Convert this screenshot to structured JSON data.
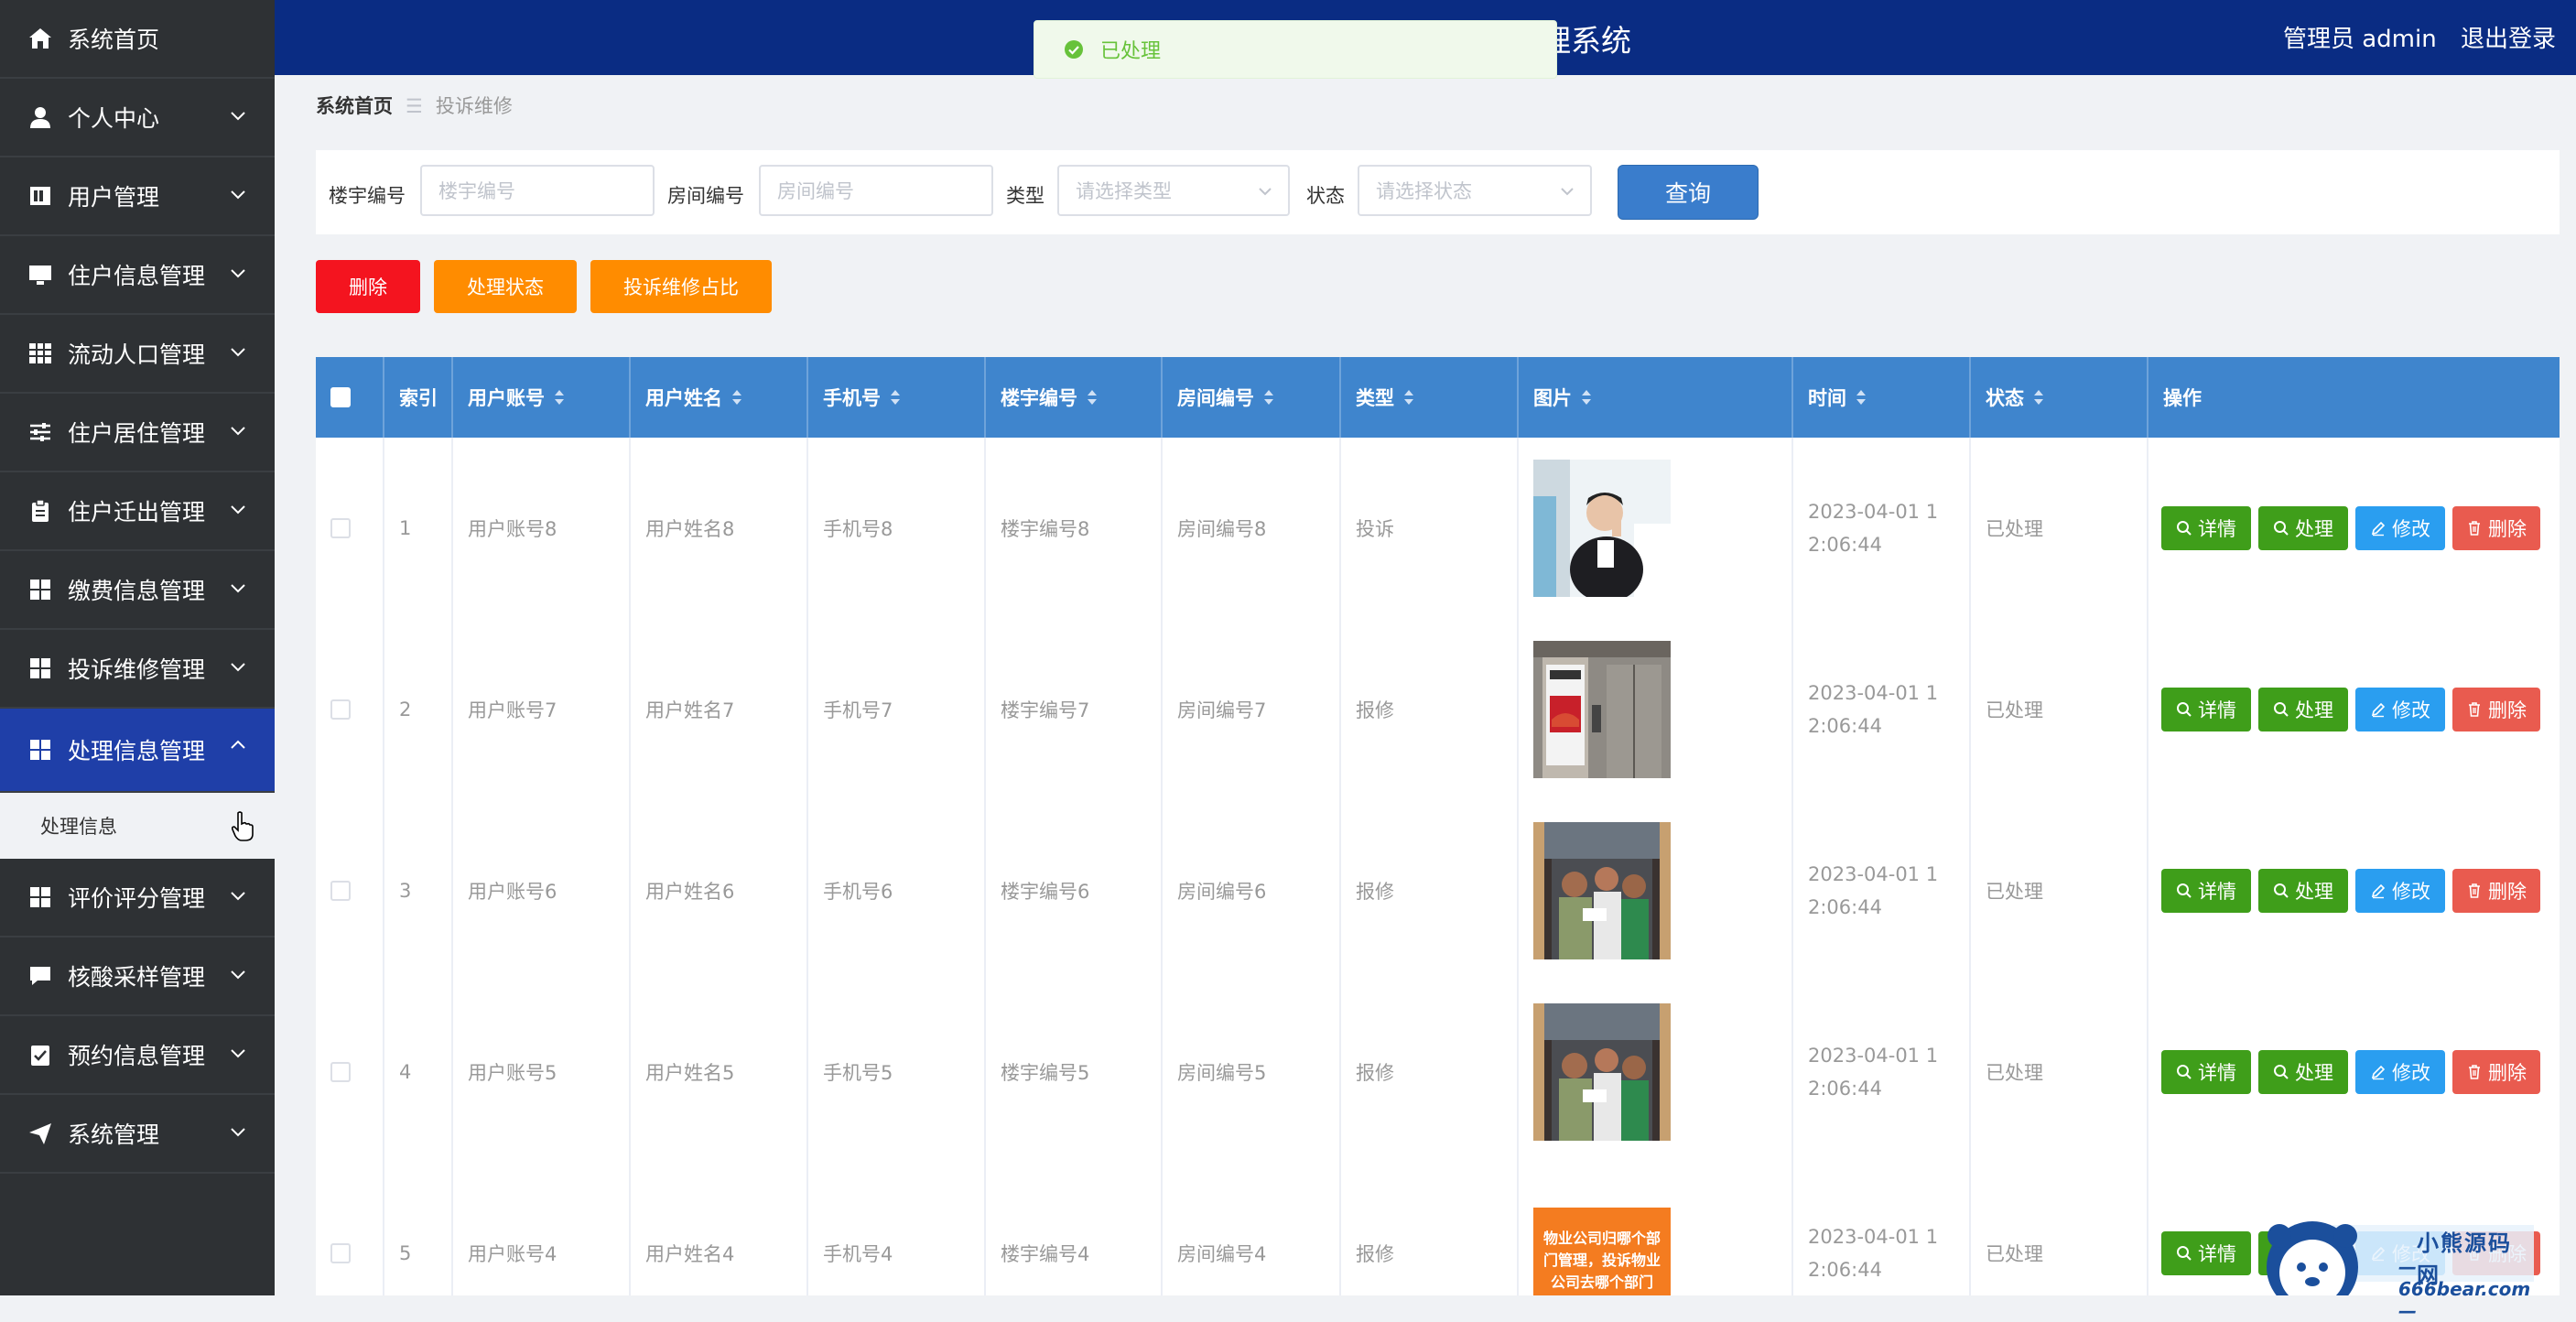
{
  "sidebar": {
    "items": [
      {
        "label": "系统首页",
        "icon": "home-icon"
      },
      {
        "label": "个人中心",
        "icon": "person-icon"
      },
      {
        "label": "用户管理",
        "icon": "users-icon"
      },
      {
        "label": "住户信息管理",
        "icon": "monitor-icon"
      },
      {
        "label": "流动人口管理",
        "icon": "grid-icon"
      },
      {
        "label": "住户居住管理",
        "icon": "sliders-icon"
      },
      {
        "label": "住户迁出管理",
        "icon": "clipboard-icon"
      },
      {
        "label": "缴费信息管理",
        "icon": "apps-icon"
      },
      {
        "label": "投诉维修管理",
        "icon": "apps-icon"
      },
      {
        "label": "处理信息管理",
        "icon": "apps-icon"
      },
      {
        "label": "评价评分管理",
        "icon": "apps-icon"
      },
      {
        "label": "核酸采样管理",
        "icon": "chat-icon"
      },
      {
        "label": "预约信息管理",
        "icon": "checklist-icon"
      },
      {
        "label": "系统管理",
        "icon": "send-icon"
      }
    ],
    "submenu": {
      "label": "处理信息"
    }
  },
  "header": {
    "title": "管理系统",
    "user_role": "管理员 admin",
    "logout": "退出登录"
  },
  "toast": {
    "message": "已处理"
  },
  "breadcrumb": {
    "home": "系统首页",
    "current": "投诉维修"
  },
  "search": {
    "building_label": "楼宇编号",
    "building_placeholder": "楼宇编号",
    "room_label": "房间编号",
    "room_placeholder": "房间编号",
    "type_label": "类型",
    "type_placeholder": "请选择类型",
    "status_label": "状态",
    "status_placeholder": "请选择状态",
    "query_button": "查询"
  },
  "actions": {
    "delete": "删除",
    "process_status": "处理状态",
    "ratio": "投诉维修占比"
  },
  "table": {
    "headers": {
      "index": "索引",
      "account": "用户账号",
      "name": "用户姓名",
      "phone": "手机号",
      "building": "楼宇编号",
      "room": "房间编号",
      "type": "类型",
      "image": "图片",
      "time": "时间",
      "status": "状态",
      "ops": "操作"
    },
    "op_labels": {
      "detail": "详情",
      "process": "处理",
      "edit": "修改",
      "delete": "删除"
    },
    "rows": [
      {
        "index": "1",
        "account": "用户账号8",
        "name": "用户姓名8",
        "phone": "手机号8",
        "building": "楼宇编号8",
        "room": "房间编号8",
        "type": "投诉",
        "time": "2023-04-01 12:06:44",
        "status": "已处理"
      },
      {
        "index": "2",
        "account": "用户账号7",
        "name": "用户姓名7",
        "phone": "手机号7",
        "building": "楼宇编号7",
        "room": "房间编号7",
        "type": "报修",
        "time": "2023-04-01 12:06:44",
        "status": "已处理"
      },
      {
        "index": "3",
        "account": "用户账号6",
        "name": "用户姓名6",
        "phone": "手机号6",
        "building": "楼宇编号6",
        "room": "房间编号6",
        "type": "报修",
        "time": "2023-04-01 12:06:44",
        "status": "已处理"
      },
      {
        "index": "4",
        "account": "用户账号5",
        "name": "用户姓名5",
        "phone": "手机号5",
        "building": "楼宇编号5",
        "room": "房间编号5",
        "type": "报修",
        "time": "2023-04-01 12:06:44",
        "status": "已处理"
      },
      {
        "index": "5",
        "account": "用户账号4",
        "name": "用户姓名4",
        "phone": "手机号4",
        "building": "楼宇编号4",
        "room": "房间编号4",
        "type": "报修",
        "time": "2023-04-01 12:06:44",
        "status": "已处理"
      }
    ],
    "image_5_caption": "物业公司归哪个部门管理，投诉物业公司去哪个部门"
  },
  "watermark": {
    "name": "小熊源码网",
    "url": "—666bear.com—"
  },
  "colors": {
    "sidebar_bg": "#2e3134",
    "sidebar_active": "#1f3fa8",
    "header_bg": "#0a2c83",
    "table_header": "#3f85cd",
    "success": "#67c23a",
    "danger": "#f4141f",
    "warning": "#ff8c00",
    "primary": "#3a7dcc",
    "info": "#2a9ef0",
    "delete_btn": "#e95b4f",
    "green_btn": "#3f9e1a"
  }
}
